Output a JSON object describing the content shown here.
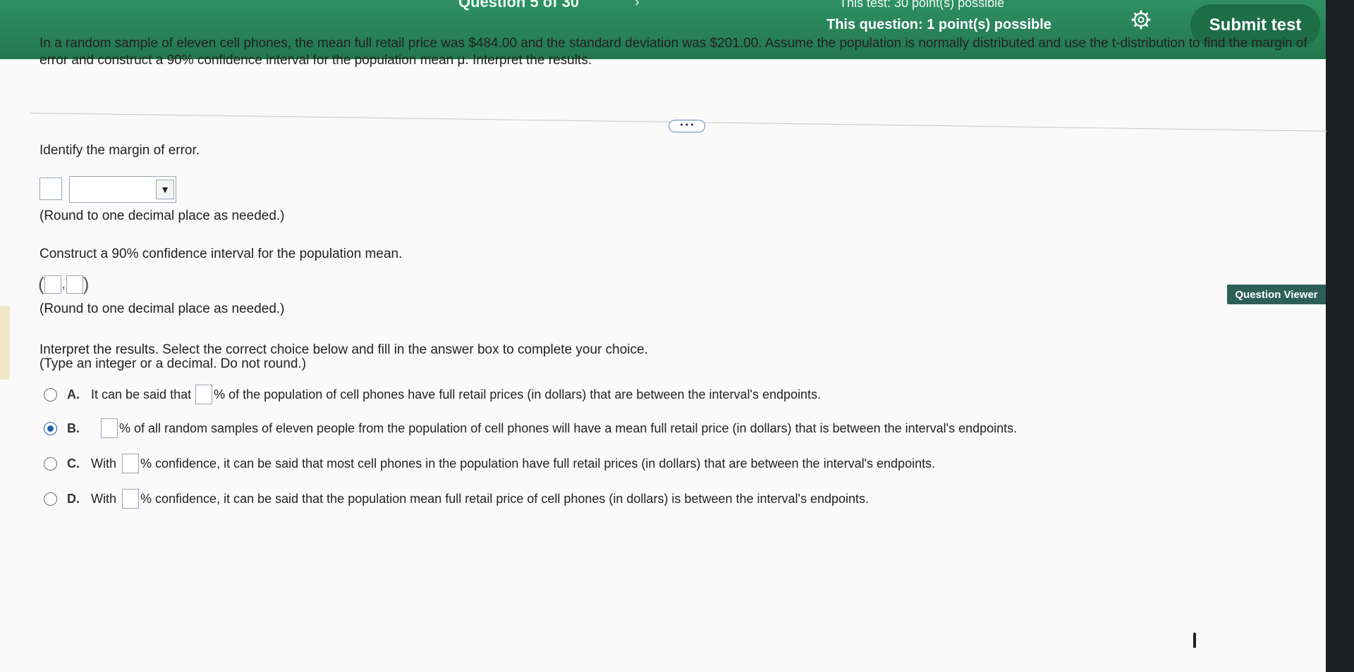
{
  "header": {
    "question_label": "Question 5 of 30",
    "nav_next": "›",
    "test_points": "This test: 30 point(s) possible",
    "question_points": "This question: 1 point(s) possible",
    "submit_label": "Submit test"
  },
  "problem_text": "In a random sample of eleven cell phones, the mean full retail price was $484.00 and the standard deviation was $201.00. Assume the population is normally distributed and use the t-distribution to find the margin of error and construct a 90% confidence interval for the population mean μ. Interpret the results.",
  "more_label": "• • •",
  "part1": {
    "prompt": "Identify the margin of error.",
    "hint": "(Round to one decimal place as needed.)"
  },
  "part2": {
    "prompt": "Construct a 90% confidence interval for the population mean.",
    "open_paren": "(",
    "comma": ",",
    "close_paren": ")",
    "hint": "(Round to one decimal place as needed.)"
  },
  "part3": {
    "prompt": "Interpret the results. Select the correct choice below and fill in the answer box to complete your choice.",
    "hint": "(Type an integer or a decimal. Do not round.)",
    "choices": [
      {
        "letter": "A.",
        "before": "It can be said that",
        "after": "% of the population of cell phones have full retail prices (in dollars) that are between the interval's endpoints.",
        "selected": false
      },
      {
        "letter": "B.",
        "before": "",
        "after": "% of all random samples of eleven people from the population of cell phones will have a mean full retail price (in dollars) that is between the interval's endpoints.",
        "selected": true
      },
      {
        "letter": "C.",
        "before": "With",
        "after": "% confidence, it can be said that most cell phones in the population have full retail prices (in dollars) that are between the interval's endpoints.",
        "selected": false
      },
      {
        "letter": "D.",
        "before": "With",
        "after": "% confidence, it can be said that the population mean full retail price of cell phones (in dollars) is between the interval's endpoints.",
        "selected": false
      }
    ]
  },
  "question_viewer_label": "Question Viewer",
  "colors": {
    "header_green": "#2f8f63",
    "submit_green": "#1d6d47",
    "viewer_bg": "#2e5f55",
    "radio_selected": "#1f5fb0"
  }
}
